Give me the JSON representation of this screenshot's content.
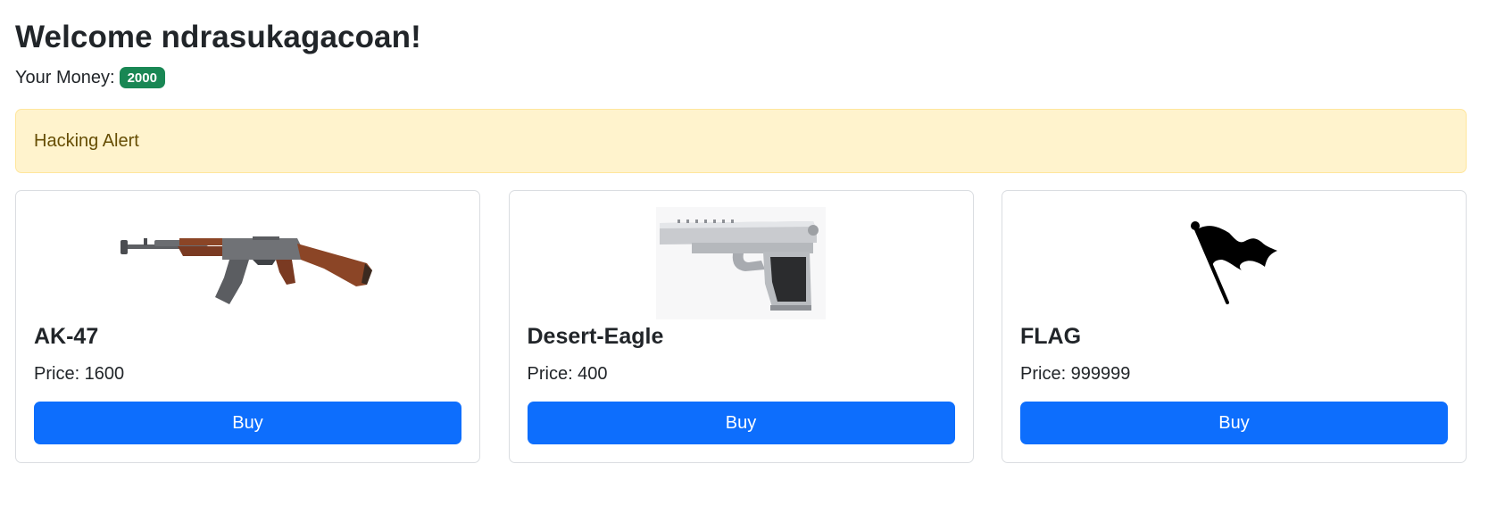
{
  "header": {
    "welcome": "Welcome ndrasukagacoan!",
    "money_label": "Your Money:",
    "money_value": "2000"
  },
  "alert": {
    "text": "Hacking Alert"
  },
  "products": [
    {
      "name": "AK-47",
      "price": "Price: 1600",
      "button": "Buy",
      "icon": "rifle-image"
    },
    {
      "name": "Desert-Eagle",
      "price": "Price: 400",
      "button": "Buy",
      "icon": "pistol-image"
    },
    {
      "name": "FLAG",
      "price": "Price: 999999",
      "button": "Buy",
      "icon": "flag-icon"
    }
  ],
  "colors": {
    "primary": "#0d6efd",
    "success": "#198754",
    "warning_bg": "#fff3cd",
    "warning_text": "#664d03"
  }
}
